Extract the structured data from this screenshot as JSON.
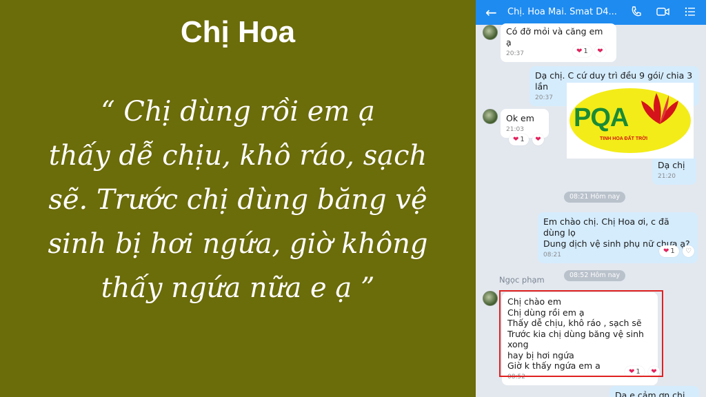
{
  "quote_panel": {
    "name": "Chị Hoa",
    "quote_lines": [
      "“ Chị dùng rồi em ạ",
      "thấy dễ chịu, khô ráo, sạch",
      "sẽ. Trước chị dùng băng vệ",
      "sinh bị hơi ngứa, giờ không",
      "thấy ngứa nữa e ạ ”"
    ]
  },
  "chat": {
    "header": {
      "back_icon": "arrow-left-icon",
      "title": "Chị. Hoa  Mai. Smat D4....",
      "icons": [
        "phone-icon",
        "video-icon",
        "list-icon"
      ],
      "accent": "#1e8bf0"
    },
    "messages": [
      {
        "dir": "in",
        "text": "Có đỡ mỏi và căng em ạ",
        "time": "20:37",
        "reactions": "1"
      },
      {
        "dir": "out",
        "text": "Dạ chị. C cứ duy trì đều 9 gói/ chia 3 lần",
        "time": "20:37"
      },
      {
        "dir": "in",
        "text": "Ok em",
        "time": "21:03",
        "reactions": "1"
      },
      {
        "dir": "out",
        "text": "Dạ chị",
        "time": "21:20"
      },
      {
        "dir": "out",
        "lines": [
          "Em chào chị. Chị Hoa ơi, c đã dùng lọ",
          "Dung dịch vệ sinh phụ nữ chưa ạ?"
        ],
        "time": "08:21",
        "reactions": "1"
      },
      {
        "dir": "in",
        "sender": "Ngọc phạm",
        "lines": [
          "Chị chào em",
          "Chị dùng rồi em ạ",
          "Thấy dễ chịu, khô ráo , sạch sẽ",
          "Trước kia chị dùng băng vệ sinh xong",
          "hay bị hơi ngứa",
          "Giờ k thấy ngứa em a"
        ],
        "time": "08:52",
        "reactions": "1"
      },
      {
        "dir": "out",
        "text": "Dạ e cảm ơn chị ak"
      }
    ],
    "date_pills": [
      "08:21 Hôm nay",
      "08:52 Hôm nay"
    ]
  },
  "logo": {
    "brand": "PQA",
    "tagline": "TINH HOA ĐẤT TRỜI",
    "colors": {
      "green": "#1a8a36",
      "yellow": "#f3ec18",
      "red": "#d4141a"
    }
  },
  "colors": {
    "panel": "#6b6c0a",
    "highlight": "#e02020"
  }
}
